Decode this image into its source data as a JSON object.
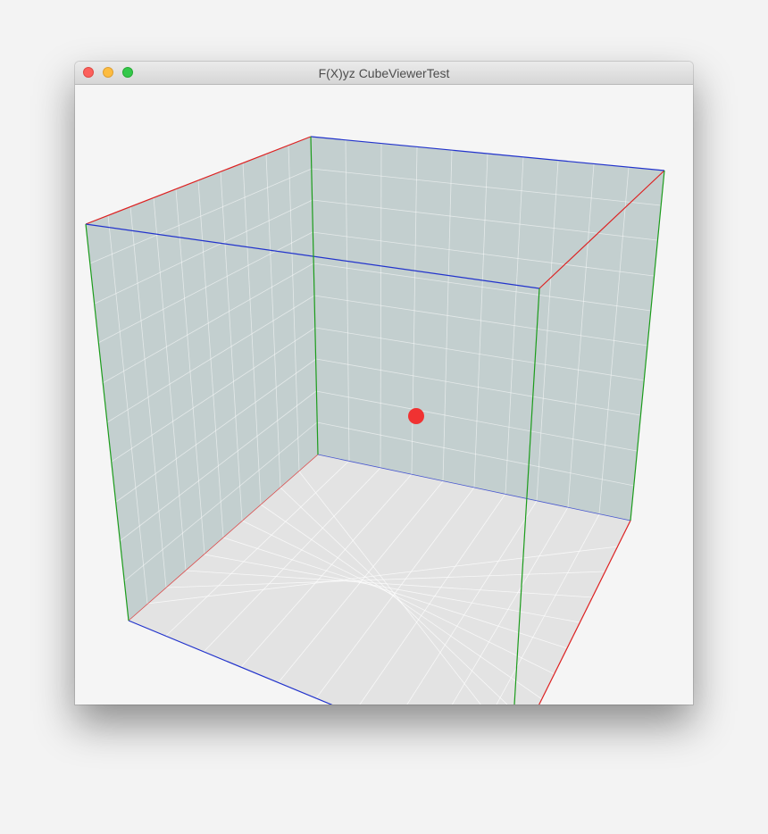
{
  "window": {
    "title": "F(X)yz CubeViewerTest",
    "controls": [
      "close",
      "minimize",
      "zoom"
    ]
  },
  "scene": {
    "type": "3d-cube-viewer",
    "panel_color": "#bccac9",
    "floor_color": "#e3e3e3",
    "grid_color": "#ffffff",
    "axis_colors": {
      "x": "#dd2222",
      "y": "#1c9c1c",
      "z": "#2233cc"
    },
    "point_color": "#f03232"
  }
}
